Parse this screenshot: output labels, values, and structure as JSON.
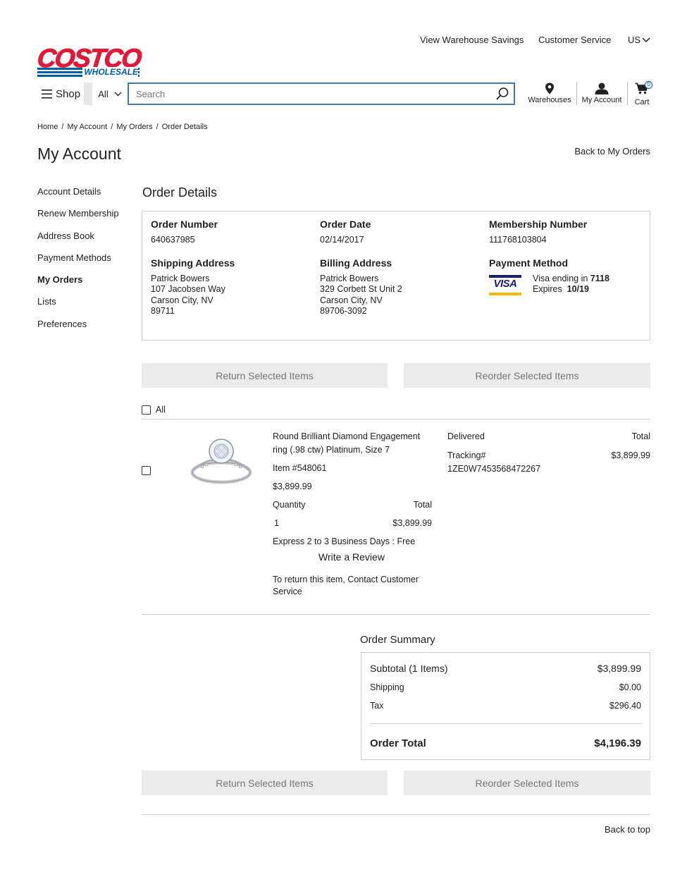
{
  "header": {
    "util_links": [
      "View Warehouse Savings",
      "Customer Service",
      "US"
    ],
    "logo_main": "COSTCO",
    "logo_sub": "WHOLESALE",
    "shop_label": "Shop",
    "category_select": "All",
    "search_placeholder": "Search",
    "nav": {
      "warehouses": "Warehouses",
      "account": "My Account",
      "cart": "Cart",
      "cart_count": "0"
    }
  },
  "breadcrumb": [
    "Home",
    "My Account",
    "My Orders",
    "Order Details"
  ],
  "page_title": "My Account",
  "back_to_orders": "Back to My Orders",
  "sidebar": {
    "items": [
      "Account Details",
      "Renew Membership",
      "Address Book",
      "Payment Methods",
      "My Orders",
      "Lists",
      "Preferences"
    ],
    "active": "My Orders"
  },
  "order": {
    "heading": "Order Details",
    "number_label": "Order Number",
    "number": "640637985",
    "date_label": "Order Date",
    "date": "02/14/2017",
    "membership_label": "Membership Number",
    "membership": "111768103804",
    "shipping_label": "Shipping Address",
    "shipping": [
      "Patrick Bowers",
      "107 Jacobsen Way",
      "Carson City, NV",
      "89711"
    ],
    "billing_label": "Billing Address",
    "billing": [
      "Patrick Bowers",
      "329 Corbett St Unit 2",
      "Carson City, NV",
      "89706-3092"
    ],
    "payment_label": "Payment Method",
    "card_brand": "VISA",
    "card_ending_prefix": "Visa ending in",
    "card_ending": "7118",
    "card_expires_prefix": "Expires",
    "card_expires": "10/19"
  },
  "actions": {
    "return_label": "Return Selected Items",
    "reorder_label": "Reorder Selected Items",
    "select_all_label": "All"
  },
  "item": {
    "name": "Round Brilliant Diamond Engagement ring (.98 ctw) Platinum, Size 7",
    "item_number": "Item #548061",
    "price": "$3,899.99",
    "quantity_label": "Quantity",
    "total_label": "Total",
    "quantity": "1",
    "line_total": "$3,899.99",
    "shipping_method": "Express 2 to 3 Business Days : Free",
    "review_label": "Write a Review",
    "return_note": "To return this item, Contact Customer Service",
    "status": "Delivered",
    "status_total_label": "Total",
    "tracking_label": "Tracking#",
    "tracking_number": "1ZE0W7453568472267",
    "status_total": "$3,899.99"
  },
  "summary": {
    "heading": "Order Summary",
    "subtotal_label": "Subtotal (1 Items)",
    "subtotal": "$3,899.99",
    "shipping_label": "Shipping",
    "shipping": "$0.00",
    "tax_label": "Tax",
    "tax": "$296.40",
    "total_label": "Order Total",
    "total": "$4,196.39"
  },
  "back_to_top": "Back to top",
  "colors": {
    "brand_red": "#e31837",
    "brand_blue": "#005daa",
    "search_border": "#3a7ab8",
    "button_bg": "#ebebeb"
  }
}
